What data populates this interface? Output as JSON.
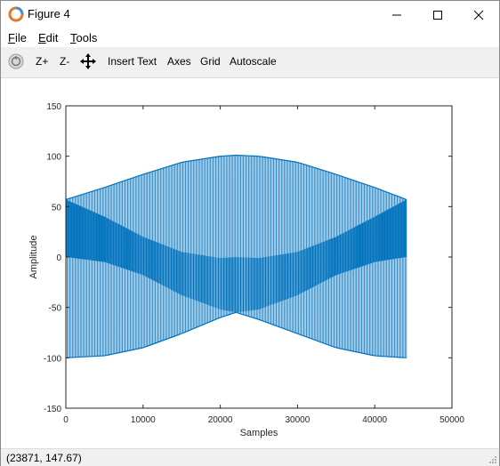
{
  "window": {
    "title": "Figure 4"
  },
  "menu": {
    "file": "File",
    "edit": "Edit",
    "tools": "Tools"
  },
  "toolbar": {
    "rotate_icon": "rotate-icon",
    "zoom_in_label": "Z+",
    "zoom_out_label": "Z-",
    "pan_icon": "pan-icon",
    "insert_text_label": "Insert Text",
    "axes_label": "Axes",
    "grid_label": "Grid",
    "autoscale_label": "Autoscale"
  },
  "status": {
    "coordinates": "(23871, 147.67)"
  },
  "colors": {
    "series": "#0072bd",
    "toolbar_bg": "#f0f0f0"
  },
  "chart_data": {
    "type": "line",
    "title": "",
    "xlabel": "Samples",
    "ylabel": "Amplitude",
    "xlim": [
      0,
      50000
    ],
    "ylim": [
      -150,
      150
    ],
    "xticks": [
      0,
      10000,
      20000,
      30000,
      40000,
      50000
    ],
    "yticks": [
      -150,
      -100,
      -50,
      0,
      50,
      100,
      150
    ],
    "grid": false,
    "legend": "none",
    "series": [
      {
        "description_kind": "dense oscillation between two envelope curves",
        "x": [
          0,
          5000,
          10000,
          15000,
          20000,
          22050,
          25000,
          30000,
          35000,
          40000,
          44100
        ],
        "upper_envelope": [
          57,
          69,
          82,
          94,
          100,
          101,
          100,
          94,
          82,
          69,
          57
        ],
        "lower_envelope": [
          -100,
          -98,
          -90,
          -76,
          -60,
          -55,
          -62,
          -76,
          -90,
          -98,
          -100
        ],
        "inner_upper": [
          57,
          40,
          20,
          5,
          -1,
          0,
          -1,
          5,
          20,
          40,
          57
        ],
        "inner_lower": [
          0,
          -5,
          -18,
          -38,
          -52,
          -55,
          -52,
          -38,
          -18,
          -5,
          0
        ]
      }
    ]
  }
}
